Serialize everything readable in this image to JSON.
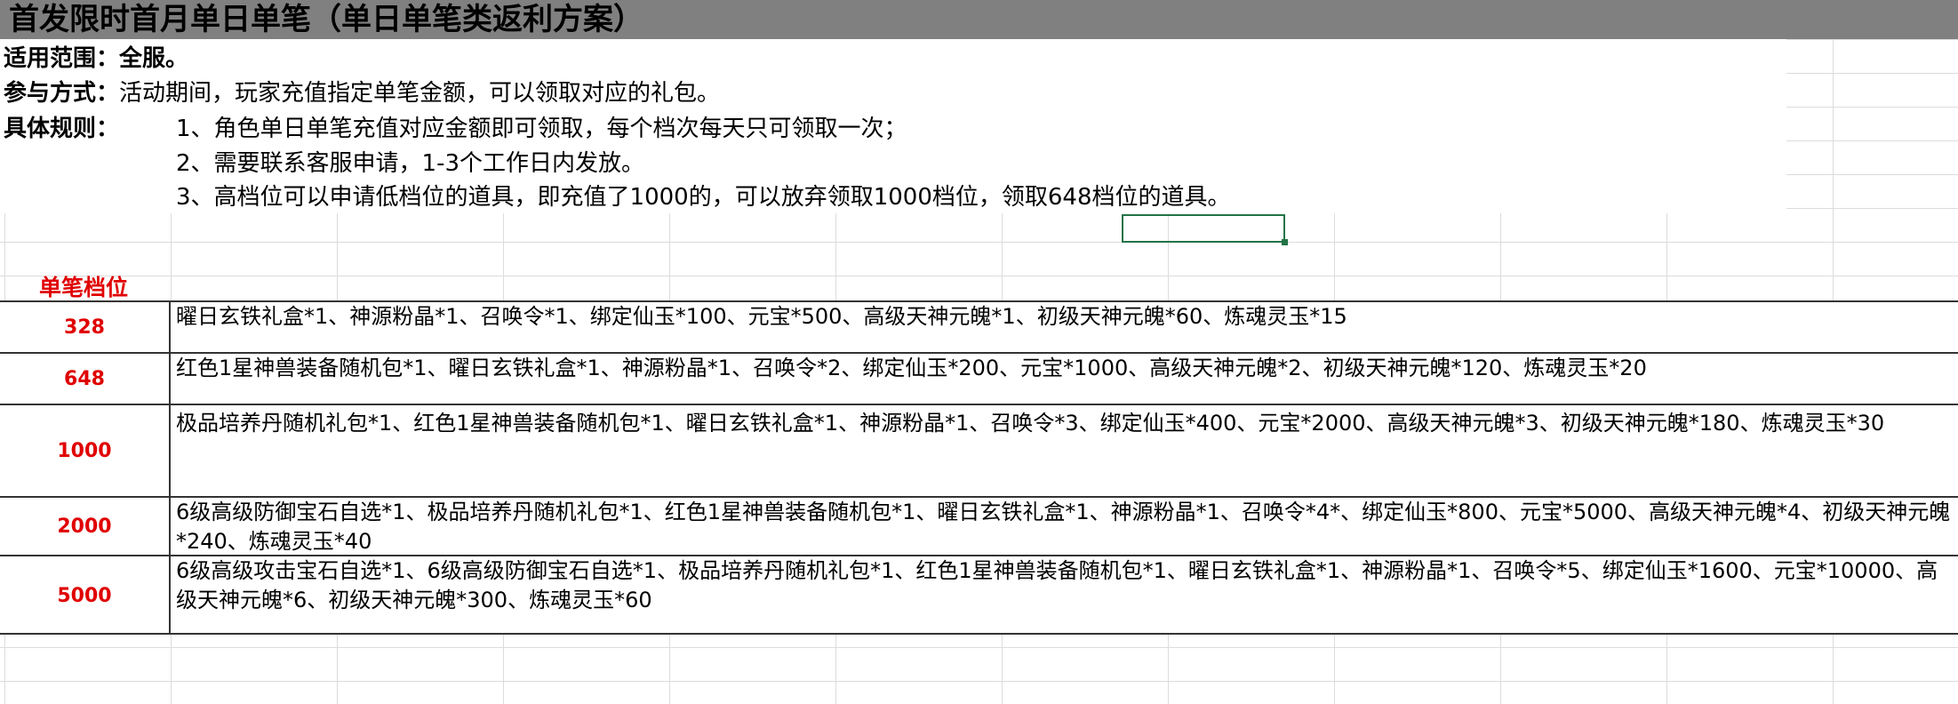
{
  "title": "首发限时首月单日单笔（单日单笔类返利方案）",
  "scope": {
    "label": "适用范围：",
    "value": "全服。"
  },
  "method": {
    "label": "参与方式：",
    "value": "活动期间，玩家充值指定单笔金额，可以领取对应的礼包。"
  },
  "rules": {
    "label": "具体规则：",
    "items": [
      "1、角色单日单笔充值对应金额即可领取，每个档次每天只可领取一次；",
      "2、需要联系客服申请，1-3个工作日内发放。",
      "3、高档位可以申请低档位的道具，即充值了1000的，可以放弃领取1000档位，领取648档位的道具。"
    ]
  },
  "table": {
    "tier_header": "单笔档位",
    "rows": [
      {
        "tier": "328",
        "reward": "曜日玄铁礼盒*1、神源粉晶*1、召唤令*1、绑定仙玉*100、元宝*500、高级天神元魄*1、初级天神元魄*60、炼魂灵玉*15"
      },
      {
        "tier": "648",
        "reward": "红色1星神兽装备随机包*1、曜日玄铁礼盒*1、神源粉晶*1、召唤令*2、绑定仙玉*200、元宝*1000、高级天神元魄*2、初级天神元魄*120、炼魂灵玉*20"
      },
      {
        "tier": "1000",
        "reward": "极品培养丹随机礼包*1、红色1星神兽装备随机包*1、曜日玄铁礼盒*1、神源粉晶*1、召唤令*3、绑定仙玉*400、元宝*2000、高级天神元魄*3、初级天神元魄*180、炼魂灵玉*30"
      },
      {
        "tier": "2000",
        "reward": "6级高级防御宝石自选*1、极品培养丹随机礼包*1、红色1星神兽装备随机包*1、曜日玄铁礼盒*1、神源粉晶*1、召唤令*4*、绑定仙玉*800、元宝*5000、高级天神元魄*4、初级天神元魄*240、炼魂灵玉*40"
      },
      {
        "tier": "5000",
        "reward": "6级高级攻击宝石自选*1、6级高级防御宝石自选*1、极品培养丹随机礼包*1、红色1星神兽装备随机包*1、曜日玄铁礼盒*1、神源粉晶*1、召唤令*5、绑定仙玉*1600、元宝*10000、高级天神元魄*6、初级天神元魄*300、炼魂灵玉*60"
      }
    ]
  }
}
